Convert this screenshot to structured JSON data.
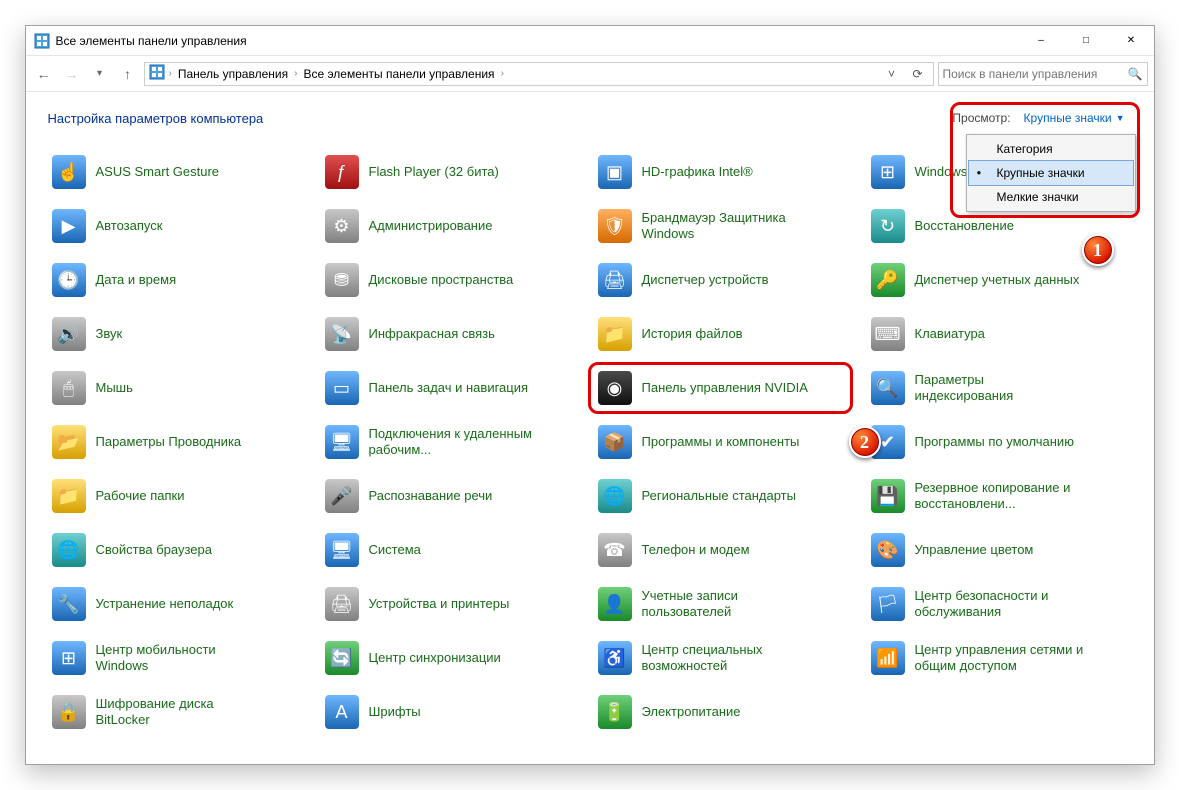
{
  "titlebar": {
    "title": "Все элементы панели управления"
  },
  "breadcrumb": {
    "items": [
      "Панель управления",
      "Все элементы панели управления"
    ]
  },
  "search": {
    "placeholder": "Поиск в панели управления"
  },
  "header": {
    "title": "Настройка параметров компьютера",
    "view_label": "Просмотр:",
    "view_value": "Крупные значки"
  },
  "dropdown": {
    "items": [
      {
        "label": "Категория",
        "selected": false
      },
      {
        "label": "Крупные значки",
        "selected": true
      },
      {
        "label": "Мелкие значки",
        "selected": false
      }
    ]
  },
  "callouts": {
    "one": "1",
    "two": "2"
  },
  "items": [
    {
      "label": "ASUS Smart Gesture",
      "ic": "ic-blue",
      "glyph": "☝"
    },
    {
      "label": "Flash Player (32 бита)",
      "ic": "ic-red",
      "glyph": "ƒ"
    },
    {
      "label": "HD-графика Intel®",
      "ic": "ic-blue",
      "glyph": "▣"
    },
    {
      "label": "Windows To Go",
      "ic": "ic-blue",
      "glyph": "⊞"
    },
    {
      "label": "Автозапуск",
      "ic": "ic-blue",
      "glyph": "▶"
    },
    {
      "label": "Администрирование",
      "ic": "ic-gray",
      "glyph": "⚙"
    },
    {
      "label": "Брандмауэр Защитника Windows",
      "ic": "ic-orange",
      "glyph": "🛡"
    },
    {
      "label": "Восстановление",
      "ic": "ic-teal",
      "glyph": "↻"
    },
    {
      "label": "Дата и время",
      "ic": "ic-blue",
      "glyph": "🕒"
    },
    {
      "label": "Дисковые пространства",
      "ic": "ic-gray",
      "glyph": "⛃"
    },
    {
      "label": "Диспетчер устройств",
      "ic": "ic-blue",
      "glyph": "🖨"
    },
    {
      "label": "Диспетчер учетных данных",
      "ic": "ic-green",
      "glyph": "🔑"
    },
    {
      "label": "Звук",
      "ic": "ic-gray",
      "glyph": "🔊"
    },
    {
      "label": "Инфракрасная связь",
      "ic": "ic-gray",
      "glyph": "📡"
    },
    {
      "label": "История файлов",
      "ic": "ic-yellow",
      "glyph": "📁"
    },
    {
      "label": "Клавиатура",
      "ic": "ic-gray",
      "glyph": "⌨"
    },
    {
      "label": "Мышь",
      "ic": "ic-gray",
      "glyph": "🖱"
    },
    {
      "label": "Панель задач и навигация",
      "ic": "ic-blue",
      "glyph": "▭"
    },
    {
      "label": "Панель управления NVIDIA",
      "ic": "ic-dark",
      "glyph": "◉",
      "hl": true
    },
    {
      "label": "Параметры индексирования",
      "ic": "ic-blue",
      "glyph": "🔍"
    },
    {
      "label": "Параметры Проводника",
      "ic": "ic-yellow",
      "glyph": "📂"
    },
    {
      "label": "Подключения к удаленным рабочим...",
      "ic": "ic-blue",
      "glyph": "🖥"
    },
    {
      "label": "Программы и компоненты",
      "ic": "ic-blue",
      "glyph": "📦"
    },
    {
      "label": "Программы по умолчанию",
      "ic": "ic-blue",
      "glyph": "✔"
    },
    {
      "label": "Рабочие папки",
      "ic": "ic-yellow",
      "glyph": "📁"
    },
    {
      "label": "Распознавание речи",
      "ic": "ic-gray",
      "glyph": "🎤"
    },
    {
      "label": "Региональные стандарты",
      "ic": "ic-teal",
      "glyph": "🌐"
    },
    {
      "label": "Резервное копирование и восстановлени...",
      "ic": "ic-green",
      "glyph": "💾"
    },
    {
      "label": "Свойства браузера",
      "ic": "ic-teal",
      "glyph": "🌐"
    },
    {
      "label": "Система",
      "ic": "ic-blue",
      "glyph": "🖥"
    },
    {
      "label": "Телефон и модем",
      "ic": "ic-gray",
      "glyph": "☎"
    },
    {
      "label": "Управление цветом",
      "ic": "ic-blue",
      "glyph": "🎨"
    },
    {
      "label": "Устранение неполадок",
      "ic": "ic-blue",
      "glyph": "🔧"
    },
    {
      "label": "Устройства и принтеры",
      "ic": "ic-gray",
      "glyph": "🖨"
    },
    {
      "label": "Учетные записи пользователей",
      "ic": "ic-green",
      "glyph": "👤"
    },
    {
      "label": "Центр безопасности и обслуживания",
      "ic": "ic-blue",
      "glyph": "🏳"
    },
    {
      "label": "Центр мобильности Windows",
      "ic": "ic-blue",
      "glyph": "⊞"
    },
    {
      "label": "Центр синхронизации",
      "ic": "ic-green",
      "glyph": "🔄"
    },
    {
      "label": "Центр специальных возможностей",
      "ic": "ic-blue",
      "glyph": "♿"
    },
    {
      "label": "Центр управления сетями и общим доступом",
      "ic": "ic-blue",
      "glyph": "📶"
    },
    {
      "label": "Шифрование диска BitLocker",
      "ic": "ic-gray",
      "glyph": "🔒"
    },
    {
      "label": "Шрифты",
      "ic": "ic-blue",
      "glyph": "A"
    },
    {
      "label": "Электропитание",
      "ic": "ic-green",
      "glyph": "🔋"
    }
  ]
}
